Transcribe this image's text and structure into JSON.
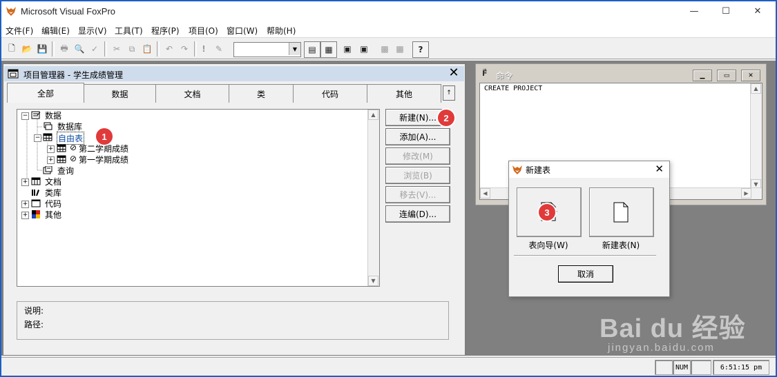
{
  "app": {
    "title": "Microsoft Visual FoxPro",
    "minimize": "—",
    "maximize": "☐",
    "close": "✕"
  },
  "menu": [
    "文件(F)",
    "编辑(E)",
    "显示(V)",
    "工具(T)",
    "程序(P)",
    "项目(O)",
    "窗口(W)",
    "帮助(H)"
  ],
  "project_manager": {
    "title": "项目管理器 - 学生成绩管理",
    "tabs": [
      "全部",
      "数据",
      "文档",
      "类",
      "代码",
      "其他"
    ],
    "tree": {
      "data": "数据",
      "database": "数据库",
      "free_tables": "自由表",
      "table1": "第二学期成绩",
      "table2": "第一学期成绩",
      "query": "查询",
      "documents": "文档",
      "class_library": "类库",
      "code": "代码",
      "other": "其他"
    },
    "buttons": {
      "new": "新建(N)...",
      "add": "添加(A)...",
      "modify": "修改(M)",
      "browse": "浏览(B)",
      "remove": "移去(V)...",
      "build": "连编(D)..."
    },
    "info": {
      "description_label": "说明:",
      "path_label": "路径:"
    }
  },
  "command_window": {
    "title": "命令",
    "text": "CREATE PROJECT"
  },
  "new_table_dialog": {
    "title": "新建表",
    "wizard": "表向导(W)",
    "new_table": "新建表(N)",
    "cancel": "取消"
  },
  "annotations": {
    "step1": "1",
    "step2": "2",
    "step3": "3"
  },
  "status": {
    "num": "NUM",
    "time": "6:51:15 pm"
  },
  "watermark": {
    "logo": "Bai du 经验",
    "url": "jingyan.baidu.com"
  },
  "colors": {
    "accent_border": "#1c5fc5",
    "badge": "#e03a3a",
    "selection_text": "#0c4da2"
  }
}
